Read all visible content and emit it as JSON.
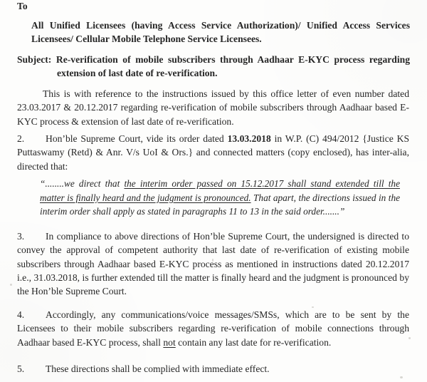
{
  "document": {
    "salutation": "To",
    "addressee": "All Unified Licensees (having Access Service Authorization)/ Unified Access Services Licensees/ Cellular Mobile Telephone Service Licensees.",
    "subject_label": "Subject:",
    "subject_text": "Re-verification of mobile subscribers through Aadhaar E-KYC process regarding extension of last date of re-verification.",
    "paragraphs": [
      {
        "number": "",
        "text": "This is with reference to the instructions issued by this office letter of even number dated 23.03.2017 & 20.12.2017 regarding re-verification of mobile subscribers through Aadhaar based E-KYC process & extension of last date of re-verification."
      },
      {
        "number": "2.",
        "text_before_date": "Hon’ble Supreme Court, vide its order dated ",
        "bold_date": "13.03.2018",
        "text_after_date": " in W.P. (C) 494/2012 {Justice KS Puttaswamy (Retd) & Anr. V/s UoI & Ors.} and connected matters (copy enclosed), has inter-alia, directed that:"
      },
      {
        "number": "3.",
        "text": "In compliance to above directions of Hon’ble Supreme Court, the undersigned is directed to convey the approval of competent authority that last date of re-verification of existing mobile subscribers through Aadhaar based E-KYC process as mentioned in instructions dated 20.12.2017 i.e., 31.03.2018, is further extended till the matter is finally heard and the judgment is pronounced by the Hon’ble Supreme Court."
      },
      {
        "number": "4.",
        "text_part1": "Accordingly, any communications/voice messages/SMSs, which are to be sent by the Licensees to their mobile subscribers regarding re-verification of mobile connections through Aadhaar based E-KYC process, shall ",
        "underlined_word": "not",
        "text_part2": " contain any last date for re-verification."
      },
      {
        "number": "5.",
        "text": "These directions shall be complied with immediate effect."
      }
    ],
    "quote": {
      "opening": "“........we direct that ",
      "underlined": "the interim order passed on 15.12.2017 shall stand extended till the matter is finally heard and the judgment is pronounced.",
      "remainder": " That apart, the directions issued in the interim order shall apply as stated in paragraphs 11 to 13 in the said order.......”"
    }
  }
}
